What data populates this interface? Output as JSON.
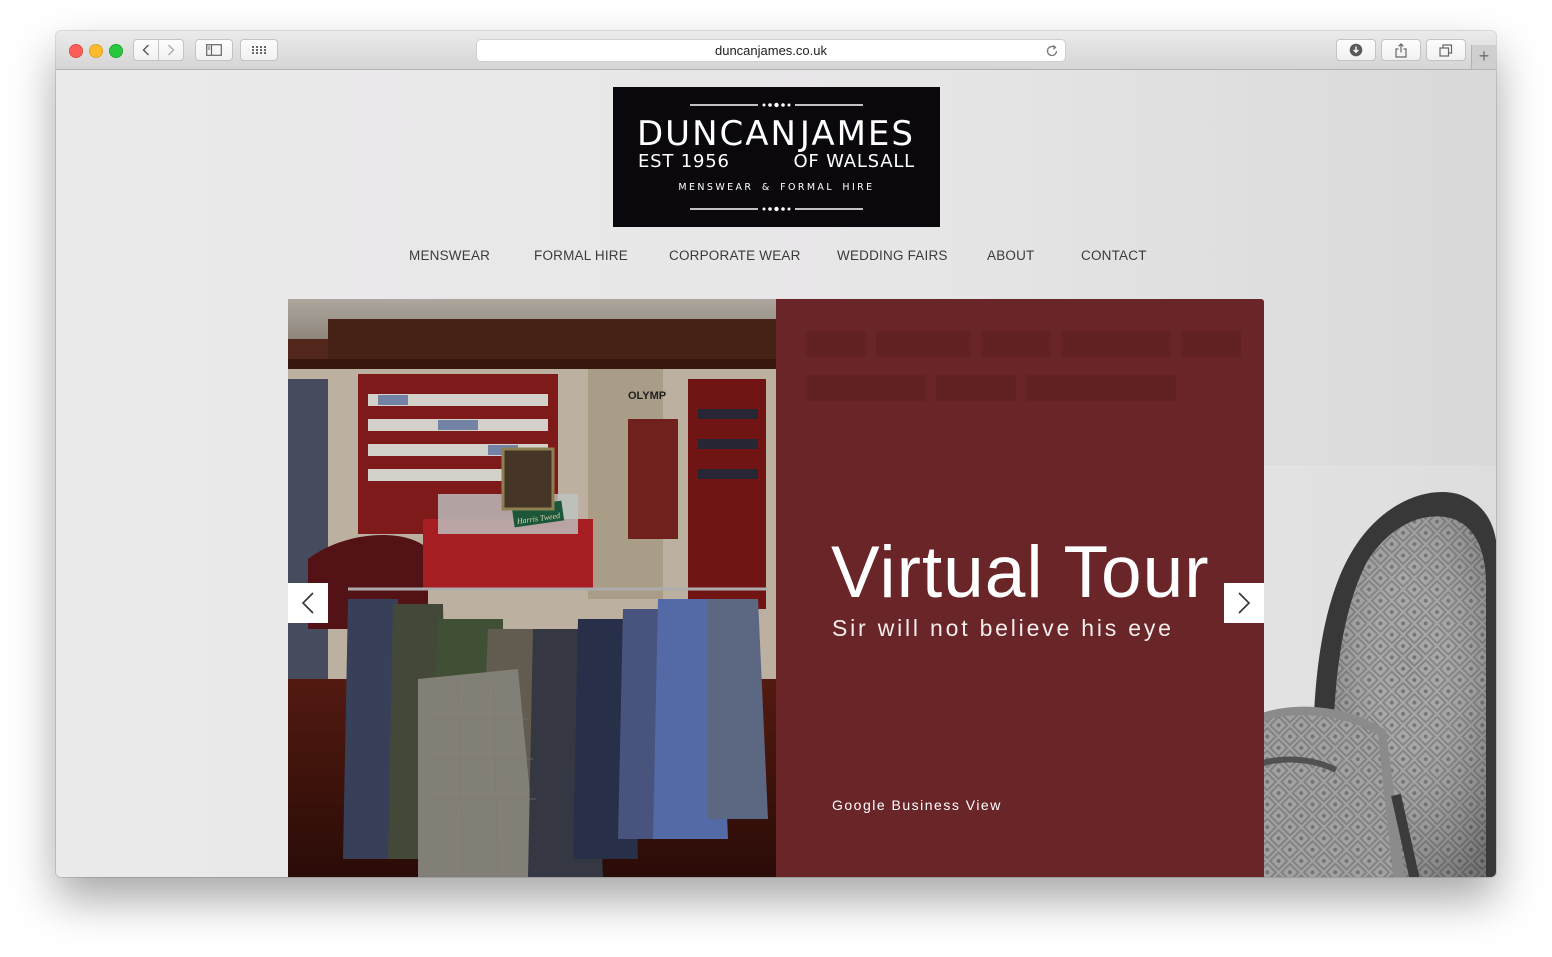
{
  "browser": {
    "url": "duncanjames.co.uk",
    "new_tab_label": "+"
  },
  "logo": {
    "name_left": "DUNCAN",
    "name_right": "JAMES",
    "est": "EST 1956",
    "location": "OF WALSALL",
    "tagline": "MENSWEAR  &  FORMAL HIRE"
  },
  "nav": {
    "items": [
      {
        "label": "MENSWEAR"
      },
      {
        "label": "FORMAL HIRE"
      },
      {
        "label": "CORPORATE WEAR"
      },
      {
        "label": "WEDDING FAIRS"
      },
      {
        "label": "ABOUT"
      },
      {
        "label": "CONTACT"
      }
    ]
  },
  "slide": {
    "headline": "Virtual Tour",
    "subline": "Sir will not believe his eye",
    "link": "Google Business View",
    "photo_sign": "OLYMP",
    "photo_tag": "Harris Tweed"
  },
  "colors": {
    "panel": "#6a2529",
    "logo_bg": "#0a080c",
    "nav_text": "#3b3b3b"
  },
  "icons": {
    "back": "chevron-left-icon",
    "forward": "chevron-right-icon",
    "sidebar": "sidebar-icon",
    "top_sites": "grid-icon",
    "reload": "reload-icon",
    "downloads": "download-icon",
    "share": "share-icon",
    "tabs": "tabs-icon",
    "slider_prev": "chevron-left-icon",
    "slider_next": "chevron-right-icon"
  }
}
